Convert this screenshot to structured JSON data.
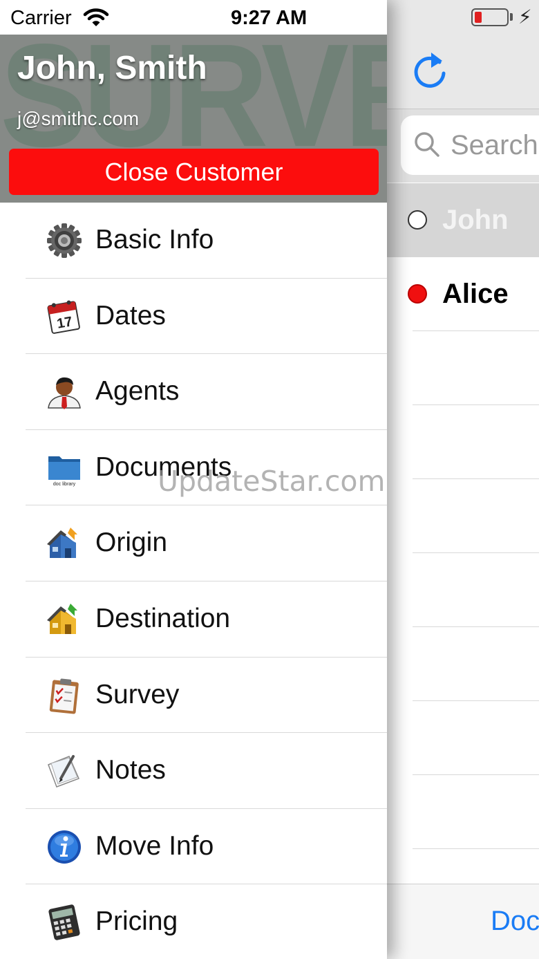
{
  "status_bar": {
    "carrier": "Carrier",
    "time": "9:27 AM"
  },
  "header": {
    "background_text": "SURVEY",
    "name": "John, Smith",
    "email": "j@smithc.com",
    "close_button": "Close Customer",
    "close_button_color": "#fc0d0d"
  },
  "menu": [
    {
      "label": "Basic Info",
      "icon": "gear-icon"
    },
    {
      "label": "Dates",
      "icon": "calendar-icon"
    },
    {
      "label": "Agents",
      "icon": "agent-icon"
    },
    {
      "label": "Documents",
      "icon": "folder-icon",
      "icon_caption": "doc library"
    },
    {
      "label": "Origin",
      "icon": "origin-house-icon"
    },
    {
      "label": "Destination",
      "icon": "destination-house-icon"
    },
    {
      "label": "Survey",
      "icon": "clipboard-icon"
    },
    {
      "label": "Notes",
      "icon": "notepad-icon"
    },
    {
      "label": "Move Info",
      "icon": "info-icon"
    },
    {
      "label": "Pricing",
      "icon": "calculator-icon"
    }
  ],
  "right_panel": {
    "search_placeholder": "Search",
    "customers": [
      {
        "name": "John",
        "status": "empty",
        "selected": true
      },
      {
        "name": "Alice",
        "status": "red"
      }
    ],
    "toolbar_button": "Doc",
    "accent_color": "#1a7cf5"
  },
  "watermark": "UpdateStar.com"
}
